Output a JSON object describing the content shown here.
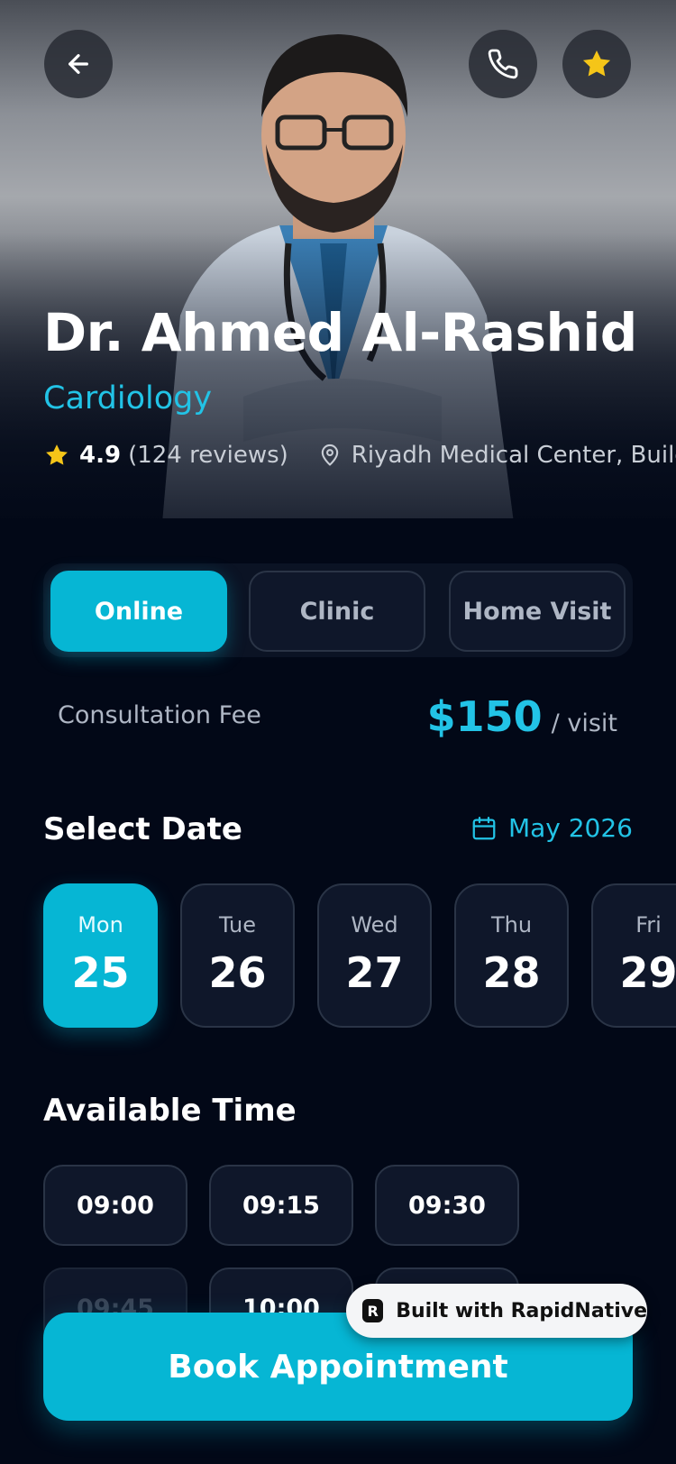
{
  "doctor": {
    "name": "Dr. Ahmed Al-Rashid",
    "specialty": "Cardiology",
    "rating": "4.9",
    "reviews": "(124 reviews)",
    "location": "Riyadh Medical Center, Building"
  },
  "consultation_types": [
    {
      "label": "Online",
      "active": true
    },
    {
      "label": "Clinic",
      "active": false
    },
    {
      "label": "Home Visit",
      "active": false
    }
  ],
  "fee": {
    "label": "Consultation Fee",
    "amount": "$150",
    "unit": "/ visit"
  },
  "date_section": {
    "title": "Select Date",
    "month": "May 2026",
    "dates": [
      {
        "day": "Mon",
        "num": "25",
        "active": true
      },
      {
        "day": "Tue",
        "num": "26",
        "active": false
      },
      {
        "day": "Wed",
        "num": "27",
        "active": false
      },
      {
        "day": "Thu",
        "num": "28",
        "active": false
      },
      {
        "day": "Fri",
        "num": "29",
        "active": false
      }
    ]
  },
  "time_section": {
    "title": "Available Time",
    "slots": [
      {
        "time": "09:00",
        "available": true
      },
      {
        "time": "09:15",
        "available": true
      },
      {
        "time": "09:30",
        "available": true
      },
      {
        "time": "09:45",
        "available": false
      },
      {
        "time": "10:00",
        "available": true
      }
    ]
  },
  "actions": {
    "book": "Book Appointment"
  },
  "badge": {
    "text": "Built with RapidNative"
  },
  "colors": {
    "accent": "#06b6d4",
    "background": "#020817",
    "star": "#f5c518"
  },
  "icons": {
    "back": "arrow-left-icon",
    "call": "phone-icon",
    "favorite": "star-icon",
    "location": "map-pin-icon",
    "calendar": "calendar-icon"
  }
}
